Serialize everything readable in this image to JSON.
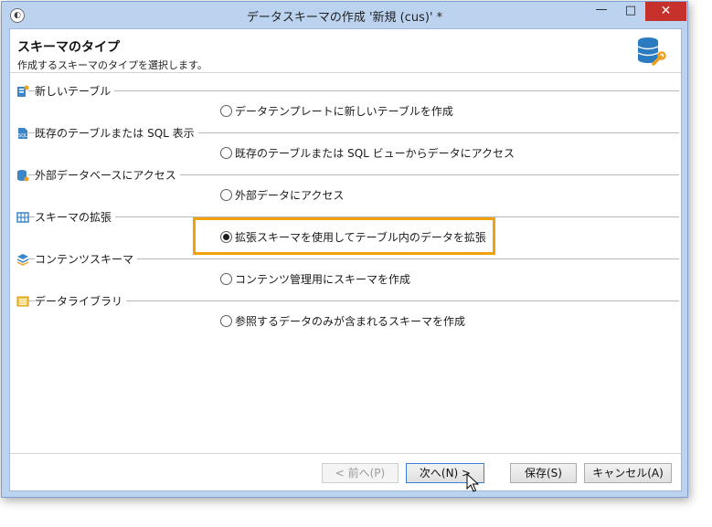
{
  "window": {
    "title": "データスキーマの作成 '新規 (cus)' *",
    "minimize": "—",
    "maximize": "□",
    "close": "✕"
  },
  "header": {
    "title": "スキーマのタイプ",
    "subtitle": "作成するスキーマのタイプを選択します。"
  },
  "sections": [
    {
      "label": "新しいテーブル",
      "icon": "new-table-icon",
      "option": "データテンプレートに新しいテーブルを作成",
      "checked": false
    },
    {
      "label": "既存のテーブルまたは SQL 表示",
      "icon": "sql-file-icon",
      "option": "既存のテーブルまたは SQL ビューからデータにアクセス",
      "checked": false
    },
    {
      "label": "外部データベースにアクセス",
      "icon": "external-database-icon",
      "option": "外部データにアクセス",
      "checked": false
    },
    {
      "label": "スキーマの拡張",
      "icon": "grid-icon",
      "option": "拡張スキーマを使用してテーブル内のデータを拡張",
      "checked": true
    },
    {
      "label": "コンテンツスキーマ",
      "icon": "content-schema-icon",
      "option": "コンテンツ管理用にスキーマを作成",
      "checked": false
    },
    {
      "label": "データライブラリ",
      "icon": "list-icon",
      "option": "参照するデータのみが含まれるスキーマを作成",
      "checked": false
    }
  ],
  "buttons": {
    "back": "< 前へ(P)",
    "next": "次へ(N) >",
    "save": "保存(S)",
    "cancel": "キャンセル(A)"
  },
  "colors": {
    "highlight": "#f0a20c",
    "close_button": "#c7312b",
    "frame": "#bcd3ef"
  }
}
